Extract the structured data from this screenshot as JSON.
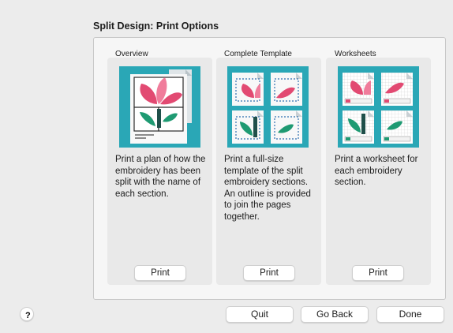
{
  "dialog": {
    "title": "Split Design: Print Options"
  },
  "panels": [
    {
      "label": "Overview",
      "description": "Print a plan of how the embroidery has been split with the name of each section.",
      "button_label": "Print"
    },
    {
      "label": "Complete Template",
      "description": "Print a full-size template of the split embroidery sections. An outline is provided to join the pages together.",
      "button_label": "Print"
    },
    {
      "label": "Worksheets",
      "description": "Print a worksheet for each embroidery section.",
      "button_label": "Print"
    }
  ],
  "footer": {
    "help_label": "?",
    "quit_label": "Quit",
    "go_back_label": "Go Back",
    "done_label": "Done"
  },
  "colors": {
    "thumbnail_bg": "#2aa7b6",
    "petal_pink": "#e24a72",
    "leaf_green": "#1e9a72",
    "stem_dark": "#1f4f4a"
  },
  "icons": {
    "overview": "overview-thumbnail-icon",
    "template": "template-thumbnail-icon",
    "worksheets": "worksheets-thumbnail-icon"
  }
}
